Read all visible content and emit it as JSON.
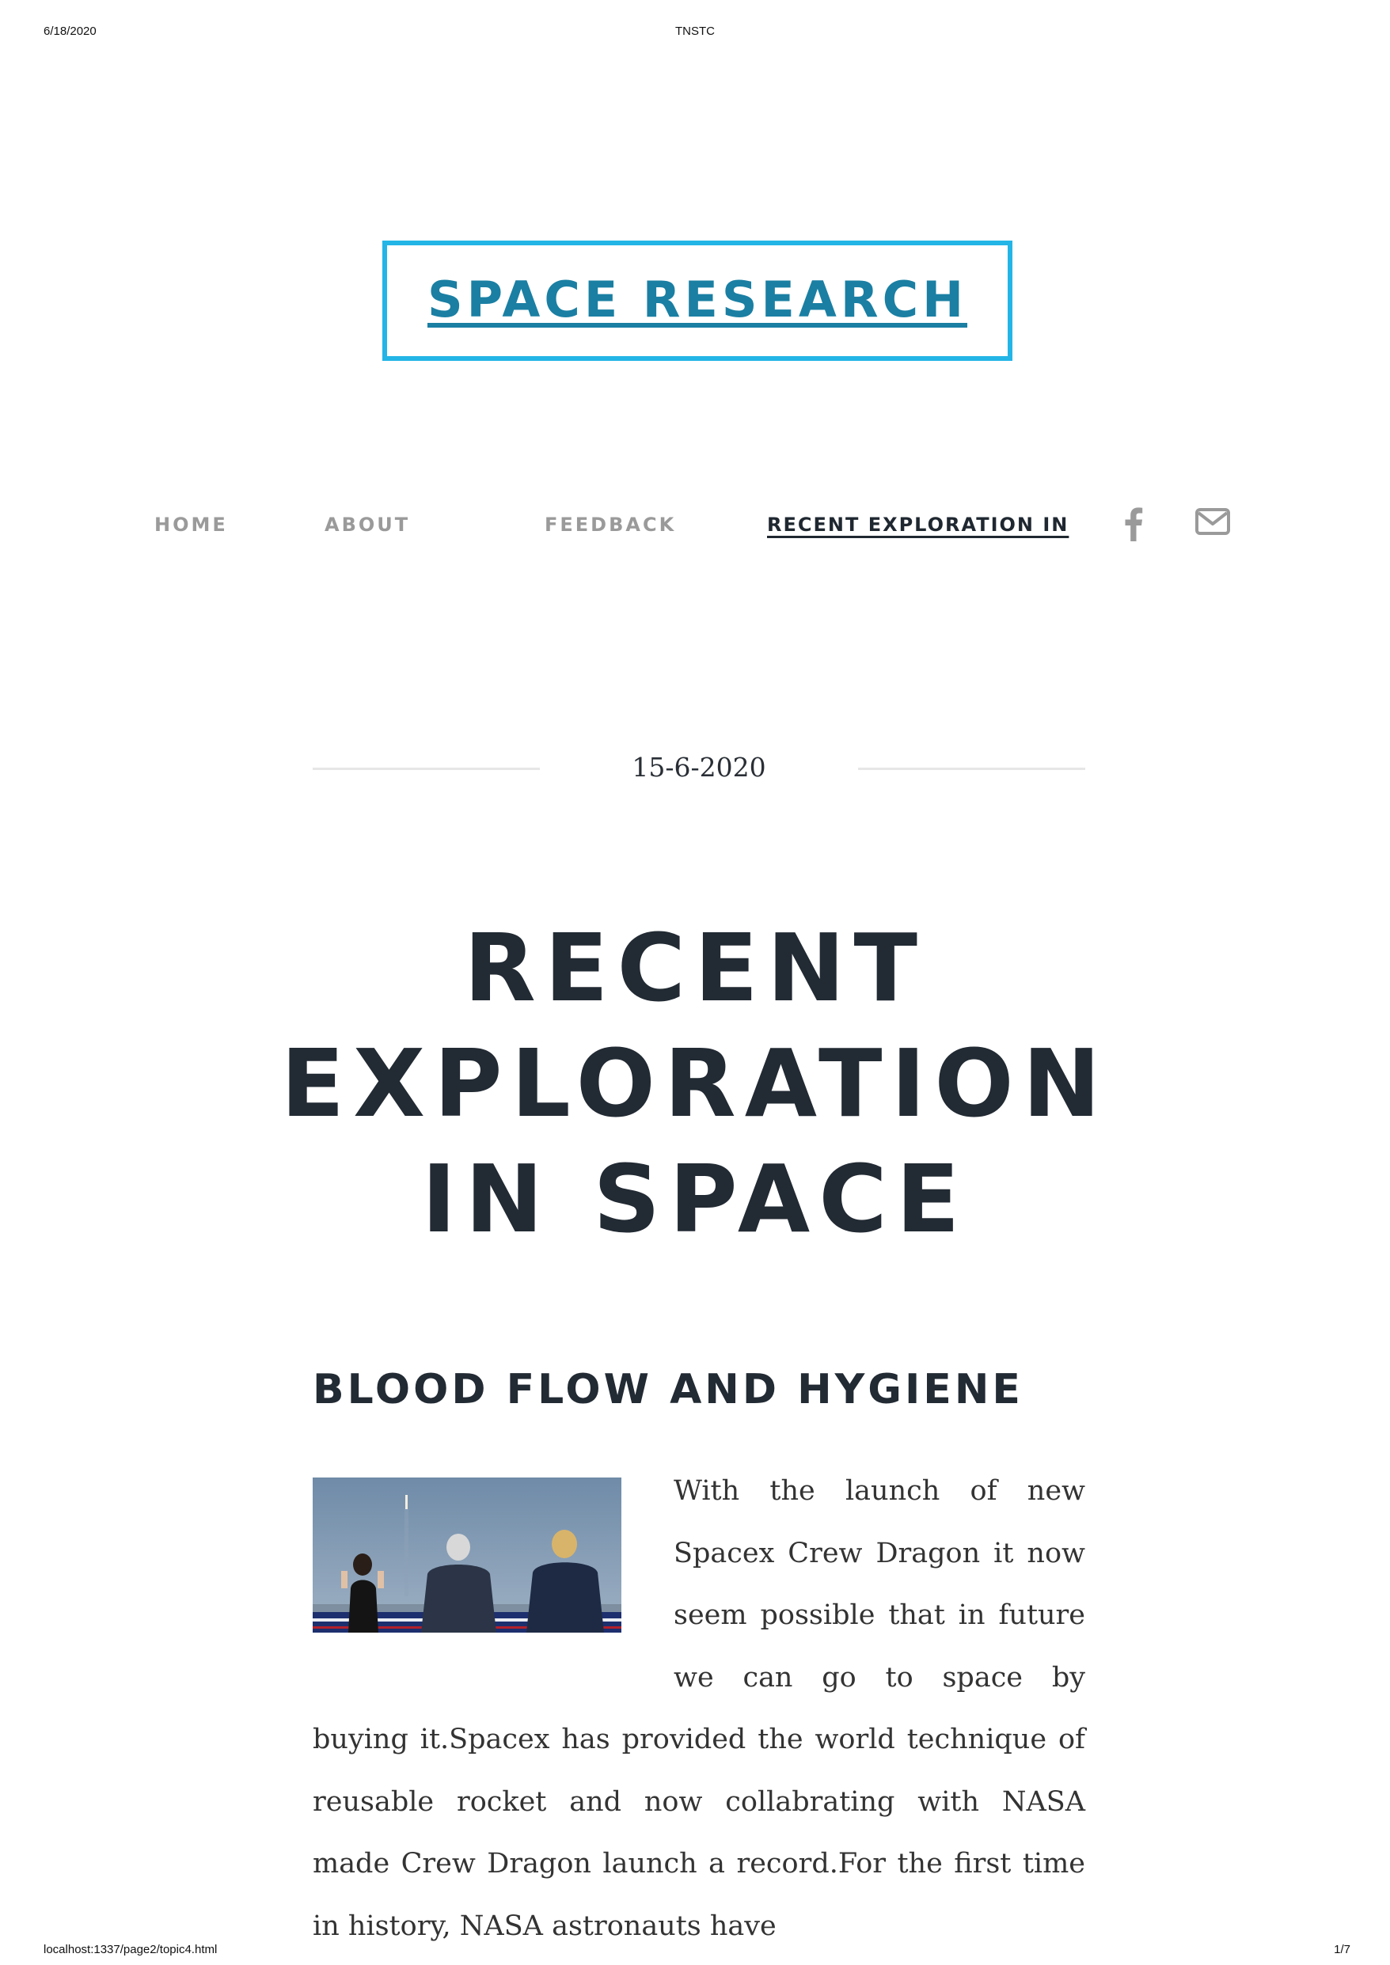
{
  "print_header": {
    "date": "6/18/2020",
    "title": "TNSTC"
  },
  "print_footer": {
    "url": "localhost:1337/page2/topic4.html",
    "page": "1/7"
  },
  "site": {
    "title": "SPACE RESEARCH"
  },
  "nav": {
    "items": [
      {
        "label": "HOME"
      },
      {
        "label": "ABOUT"
      },
      {
        "label": "FEEDBACK"
      },
      {
        "label": "RECENT EXPLORATION IN"
      }
    ],
    "icons": [
      "facebook-icon",
      "mail-icon"
    ],
    "active_color": "#1f2730",
    "inactive_color": "#9a9a9a"
  },
  "post": {
    "date": "15-6-2020",
    "title": "RECENT EXPLORATION IN SPACE",
    "section_title": "BLOOD FLOW AND HYGIENE",
    "body": "With the launch of new Spacex Crew Dragon it now seem possible that in future we can go to space by buying it.Spacex has provided the world technique of reusable rocket and now collabrating with NASA made Crew Dragon launch a record.For the first time in history, NASA astronauts have"
  },
  "colors": {
    "brand": "#1a7fa3",
    "title_border": "#23b5e6",
    "heading": "#222a33"
  }
}
